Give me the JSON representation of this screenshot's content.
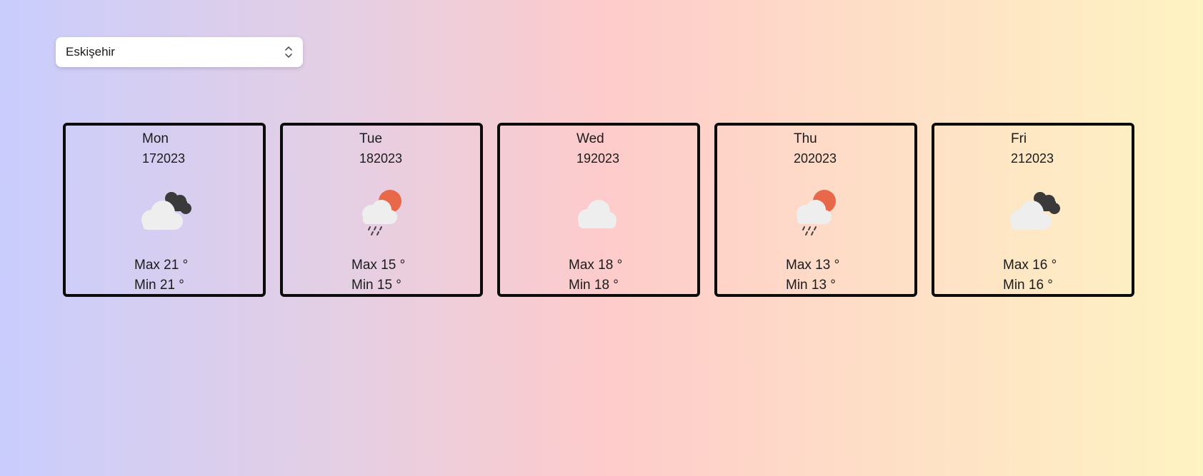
{
  "city_select": {
    "value": "Eskişehir"
  },
  "forecast": [
    {
      "day": "Mon",
      "date": "172023",
      "icon": "cloud-night-icon",
      "max": "Max 21 °",
      "min": "Min 21 °"
    },
    {
      "day": "Tue",
      "date": "182023",
      "icon": "sun-cloud-rain-icon",
      "max": "Max 15 °",
      "min": "Min 15 °"
    },
    {
      "day": "Wed",
      "date": "192023",
      "icon": "cloud-icon",
      "max": "Max 18 °",
      "min": "Min 18 °"
    },
    {
      "day": "Thu",
      "date": "202023",
      "icon": "sun-cloud-rain-icon",
      "max": "Max 13 °",
      "min": "Min 13 °"
    },
    {
      "day": "Fri",
      "date": "212023",
      "icon": "cloud-night-icon",
      "max": "Max 16 °",
      "min": "Min 16 °"
    }
  ],
  "colors": {
    "card_border": "#0c0c0c",
    "sun": "#e8684a",
    "cloud": "#eeeeee",
    "dark_cloud": "#3a3a3a"
  }
}
